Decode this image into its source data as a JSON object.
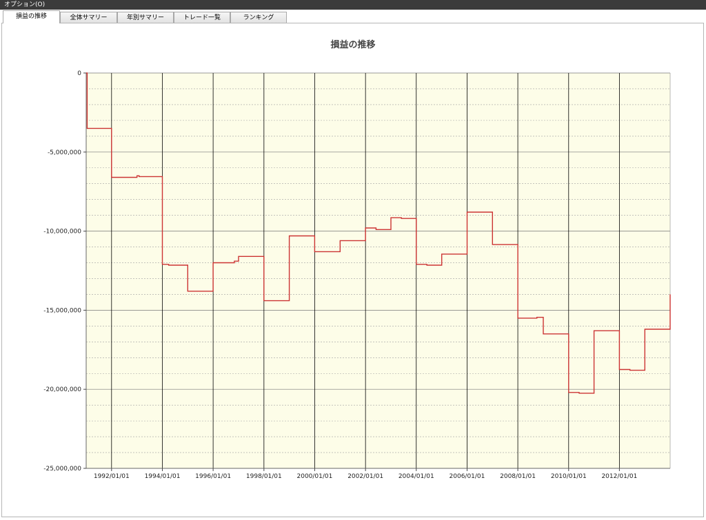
{
  "menu": {
    "items": [
      {
        "label": "オプション(O)"
      }
    ]
  },
  "tabs": [
    {
      "label": "損益の推移",
      "active": true
    },
    {
      "label": "全体サマリー",
      "active": false
    },
    {
      "label": "年別サマリー",
      "active": false
    },
    {
      "label": "トレード一覧",
      "active": false
    },
    {
      "label": "ランキング",
      "active": false
    }
  ],
  "colors": {
    "plot_background": "#fdfde8",
    "line": "#cc3333",
    "major_grid": "#000000",
    "minor_grid": "#a0a0a0"
  },
  "chart_data": {
    "type": "line",
    "title": "損益の推移",
    "xlabel": "",
    "ylabel": "",
    "grid": true,
    "step": true,
    "xlim": [
      "1991/01/01",
      "2013/12/31"
    ],
    "ylim": [
      -25000000,
      0
    ],
    "yticks": [
      0,
      -5000000,
      -10000000,
      -15000000,
      -20000000,
      -25000000
    ],
    "ytick_labels": [
      "0",
      "-5,000,000",
      "-10,000,000",
      "-15,000,000",
      "-20,000,000",
      "-25,000,000"
    ],
    "xticks": [
      "1992/01/01",
      "1994/01/01",
      "1996/01/01",
      "1998/01/01",
      "2000/01/01",
      "2002/01/01",
      "2004/01/01",
      "2006/01/01",
      "2008/01/01",
      "2010/01/01",
      "2012/01/01"
    ],
    "series": [
      {
        "x": [
          "1991/01/01",
          "1991/01/15",
          "1992/01/01",
          "1993/01/01",
          "1993/02/01",
          "1994/01/01",
          "1994/04/01",
          "1995/01/01",
          "1996/01/01",
          "1996/11/01",
          "1997/01/01",
          "1998/01/01",
          "1999/01/01",
          "2000/01/01",
          "2001/01/01",
          "2002/01/01",
          "2002/06/01",
          "2003/01/01",
          "2003/06/01",
          "2004/01/01",
          "2004/06/01",
          "2005/01/01",
          "2006/01/01",
          "2007/01/01",
          "2008/01/01",
          "2008/10/01",
          "2009/01/01",
          "2010/01/01",
          "2010/06/01",
          "2011/01/01",
          "2012/01/01",
          "2012/06/01",
          "2013/01/01",
          "2013/12/31"
        ],
        "y": [
          0,
          -3500000,
          -6600000,
          -6500000,
          -6550000,
          -12100000,
          -12150000,
          -13800000,
          -12000000,
          -11900000,
          -11600000,
          -14400000,
          -10300000,
          -11300000,
          -10600000,
          -9800000,
          -9900000,
          -9150000,
          -9200000,
          -12100000,
          -12150000,
          -11450000,
          -8800000,
          -10850000,
          -15500000,
          -15450000,
          -16500000,
          -20200000,
          -20250000,
          -16300000,
          -18750000,
          -18800000,
          -16200000,
          -14000000
        ]
      }
    ]
  }
}
